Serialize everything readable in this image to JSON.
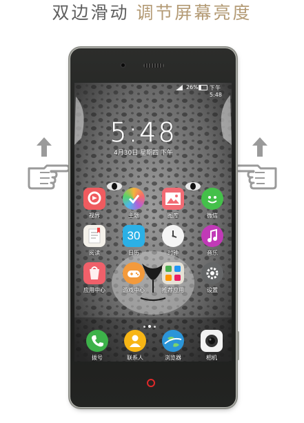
{
  "headline": {
    "part1": "双边滑动",
    "part2": "调节屏幕亮度",
    "dark_color": "#5f5f5f",
    "accent_color": "#b39a74"
  },
  "status_bar": {
    "signal_icon": "signal-icon",
    "battery_percent": "26%",
    "battery_icon": "battery-icon",
    "time": "下午5:48"
  },
  "lock_clock": {
    "time": "5:48",
    "date": "4月30日 星期四 下午"
  },
  "apps": [
    {
      "label": "视界",
      "icon": "video-icon",
      "color": "#ef5b5f"
    },
    {
      "label": "主题",
      "icon": "theme-icon",
      "color": "#f4b43b"
    },
    {
      "label": "图库",
      "icon": "gallery-icon",
      "color": "#f26b74"
    },
    {
      "label": "微信",
      "icon": "chat-icon",
      "color": "#44c04a"
    },
    {
      "label": "阅读",
      "icon": "book-icon",
      "color": "#f4f1ea"
    },
    {
      "label": "日历",
      "icon": "calendar-icon",
      "color": "#2bb0e6",
      "value": "30"
    },
    {
      "label": "时钟",
      "icon": "clock-icon",
      "color": "#f5f5f5"
    },
    {
      "label": "音乐",
      "icon": "music-icon",
      "color": "#c13ab7"
    },
    {
      "label": "应用中心",
      "icon": "app-center-icon",
      "color": "#f0606a"
    },
    {
      "label": "游戏中心",
      "icon": "gamepad-icon",
      "color": "#f39a3c"
    },
    {
      "label": "推荐应用",
      "icon": "recommend-apps-icon",
      "color": "#e6e2d6"
    },
    {
      "label": "设置",
      "icon": "settings-icon",
      "color": "#646667"
    }
  ],
  "dock": [
    {
      "label": "拨号",
      "icon": "phone-icon",
      "color": "#3db24a"
    },
    {
      "label": "联系人",
      "icon": "contacts-icon",
      "color": "#f7b515"
    },
    {
      "label": "浏览器",
      "icon": "browser-icon",
      "color": "#2b95d8"
    },
    {
      "label": "相机",
      "icon": "camera-icon",
      "color": "#333333"
    }
  ],
  "gesture": {
    "left_arrow": "up-arrow-icon",
    "right_arrow": "up-arrow-icon",
    "left_hand": "pointing-hand-right-icon",
    "right_hand": "pointing-hand-left-icon",
    "gesture_color": "#9a9a9a"
  },
  "phone": {
    "home_indicator_color": "#e0292a"
  }
}
